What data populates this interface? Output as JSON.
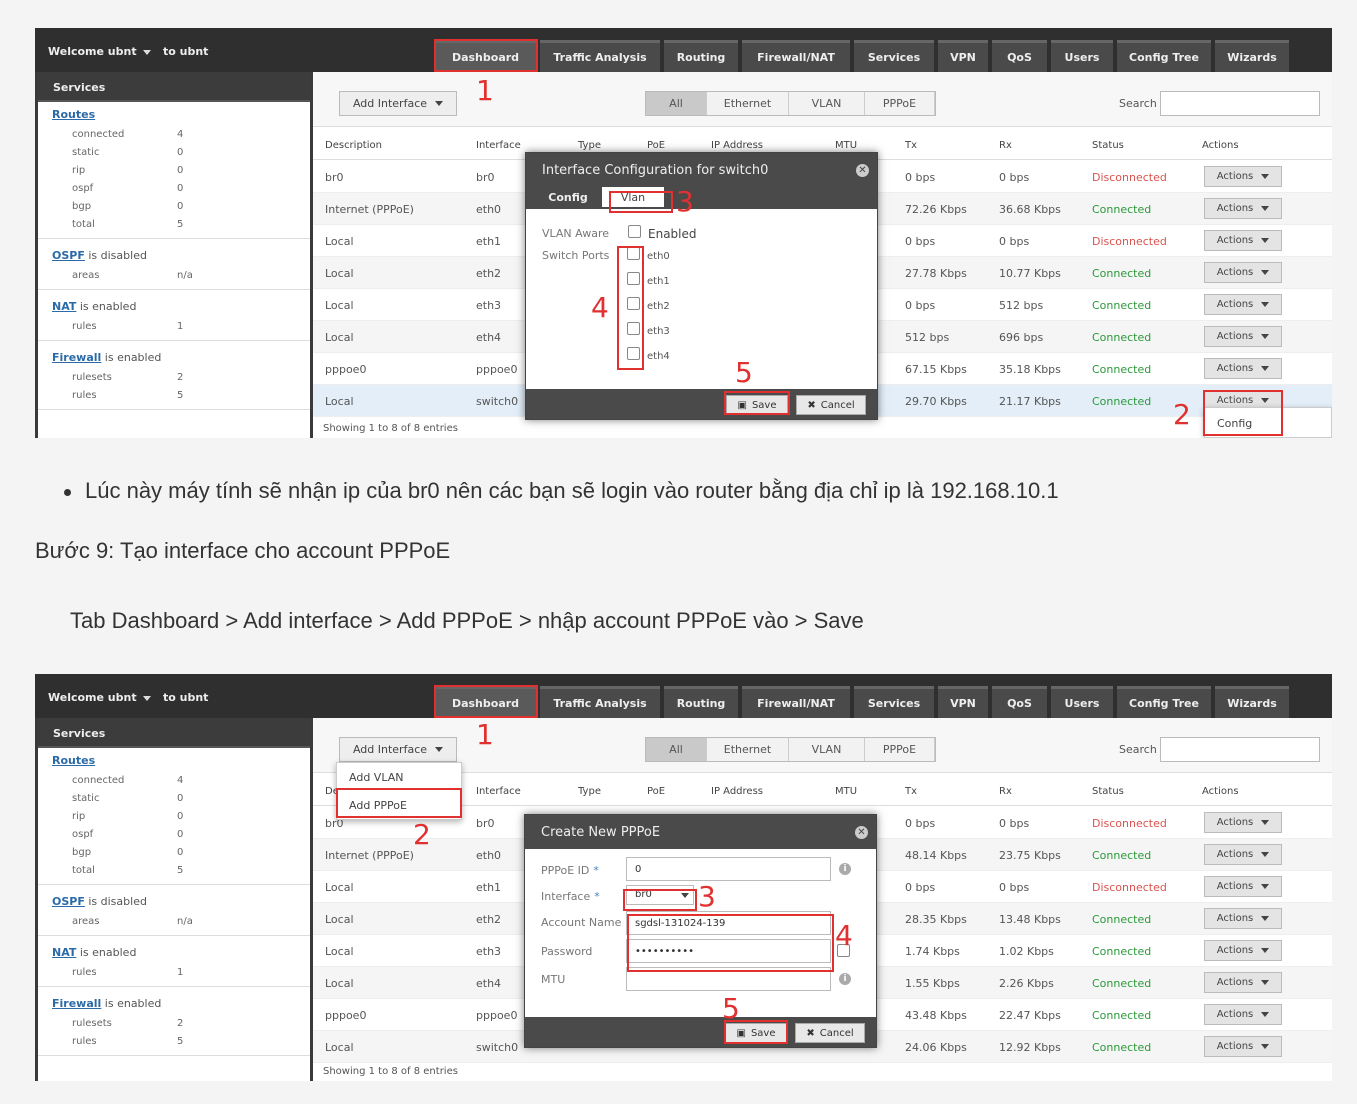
{
  "common": {
    "welcome": "Welcome ubnt",
    "to_user": "to ubnt",
    "tabs": [
      "Dashboard",
      "Traffic Analysis",
      "Routing",
      "Firewall/NAT",
      "Services",
      "VPN",
      "QoS",
      "Users",
      "Config Tree",
      "Wizards"
    ],
    "sidebar": {
      "title": "Services",
      "routes_link": "Routes",
      "routes": [
        [
          "connected",
          "4"
        ],
        [
          "static",
          "0"
        ],
        [
          "rip",
          "0"
        ],
        [
          "ospf",
          "0"
        ],
        [
          "bgp",
          "0"
        ],
        [
          "total",
          "5"
        ]
      ],
      "ospf_link": "OSPF",
      "ospf_status": " is disabled",
      "ospf_rows": [
        [
          "areas",
          "n/a"
        ]
      ],
      "nat_link": "NAT",
      "nat_status": " is enabled",
      "nat_rows": [
        [
          "rules",
          "1"
        ]
      ],
      "fw_link": "Firewall",
      "fw_status": " is enabled",
      "fw_rows": [
        [
          "rulesets",
          "2"
        ],
        [
          "rules",
          "5"
        ]
      ]
    },
    "add_interface": "Add Interface",
    "filters": [
      "All",
      "Ethernet",
      "VLAN",
      "PPPoE"
    ],
    "search_label": "Search",
    "columns": [
      "Description",
      "Interface",
      "Type",
      "PoE",
      "IP Address",
      "MTU",
      "Tx",
      "Rx",
      "Status",
      "Actions"
    ],
    "actions_label": "Actions",
    "footer": "Showing 1 to 8 of 8 entries",
    "save": "Save",
    "cancel": "Cancel",
    "colors": {
      "connected": "#2a9a3a",
      "disconnected": "#d9534f",
      "annotation": "#e03030"
    }
  },
  "shot1": {
    "rows": [
      {
        "desc": "br0",
        "iface": "br0",
        "tx": "0 bps",
        "rx": "0 bps",
        "status": "Disconnected"
      },
      {
        "desc": "Internet (PPPoE)",
        "iface": "eth0",
        "tx": "72.26 Kbps",
        "rx": "36.68 Kbps",
        "status": "Connected"
      },
      {
        "desc": "Local",
        "iface": "eth1",
        "tx": "0 bps",
        "rx": "0 bps",
        "status": "Disconnected"
      },
      {
        "desc": "Local",
        "iface": "eth2",
        "tx": "27.78 Kbps",
        "rx": "10.77 Kbps",
        "status": "Connected"
      },
      {
        "desc": "Local",
        "iface": "eth3",
        "tx": "0 bps",
        "rx": "512 bps",
        "status": "Connected"
      },
      {
        "desc": "Local",
        "iface": "eth4",
        "tx": "512 bps",
        "rx": "696 bps",
        "status": "Connected"
      },
      {
        "desc": "pppoe0",
        "iface": "pppoe0",
        "tx": "67.15 Kbps",
        "rx": "35.18 Kbps",
        "status": "Connected"
      },
      {
        "desc": "Local",
        "iface": "switch0",
        "tx": "29.70 Kbps",
        "rx": "21.17 Kbps",
        "status": "Connected"
      }
    ],
    "modal": {
      "title": "Interface Configuration for switch0",
      "tab_config": "Config",
      "tab_vlan": "Vlan",
      "vlan_aware": "VLAN Aware",
      "enabled": "Enabled",
      "switch_ports": "Switch Ports",
      "ports": [
        "eth0",
        "eth1",
        "eth2",
        "eth3",
        "eth4"
      ]
    },
    "config_item": "Config",
    "markers": [
      "1",
      "2",
      "3",
      "4",
      "5"
    ]
  },
  "text": {
    "bullet": "Lúc này máy tính sẽ nhận ip của br0 nên các bạn sẽ login vào router bằng địa chỉ ip là 192.168.10.1",
    "step": "Bước 9: Tạo interface cho account PPPoE",
    "path": "Tab Dashboard > Add interface > Add PPPoE > nhập account PPPoE vào > Save"
  },
  "shot2": {
    "rows": [
      {
        "desc": "br0",
        "iface": "br0",
        "tx": "0 bps",
        "rx": "0 bps",
        "status": "Disconnected"
      },
      {
        "desc": "Internet (PPPoE)",
        "iface": "eth0",
        "tx": "48.14 Kbps",
        "rx": "23.75 Kbps",
        "status": "Connected"
      },
      {
        "desc": "Local",
        "iface": "eth1",
        "tx": "0 bps",
        "rx": "0 bps",
        "status": "Disconnected"
      },
      {
        "desc": "Local",
        "iface": "eth2",
        "tx": "28.35 Kbps",
        "rx": "13.48 Kbps",
        "status": "Connected"
      },
      {
        "desc": "Local",
        "iface": "eth3",
        "tx": "1.74 Kbps",
        "rx": "1.02 Kbps",
        "status": "Connected"
      },
      {
        "desc": "Local",
        "iface": "eth4",
        "tx": "1.55 Kbps",
        "rx": "2.26 Kbps",
        "status": "Connected"
      },
      {
        "desc": "pppoe0",
        "iface": "pppoe0",
        "tx": "43.48 Kbps",
        "rx": "22.47 Kbps",
        "status": "Connected"
      },
      {
        "desc": "Local",
        "iface": "switch0",
        "tx": "24.06 Kbps",
        "rx": "12.92 Kbps",
        "status": "Connected"
      }
    ],
    "dropdown": [
      "Add VLAN",
      "Add PPPoE"
    ],
    "modal": {
      "title": "Create New PPPoE",
      "pppoe_id_label": "PPPoE ID",
      "pppoe_id_value": "0",
      "interface_label": "Interface",
      "interface_value": "br0",
      "account_label": "Account Name",
      "account_value": "sgdsl-131024-139",
      "password_label": "Password",
      "password_value": "••••••••••",
      "mtu_label": "MTU",
      "required": "*"
    },
    "markers": [
      "1",
      "2",
      "3",
      "4",
      "5"
    ]
  }
}
